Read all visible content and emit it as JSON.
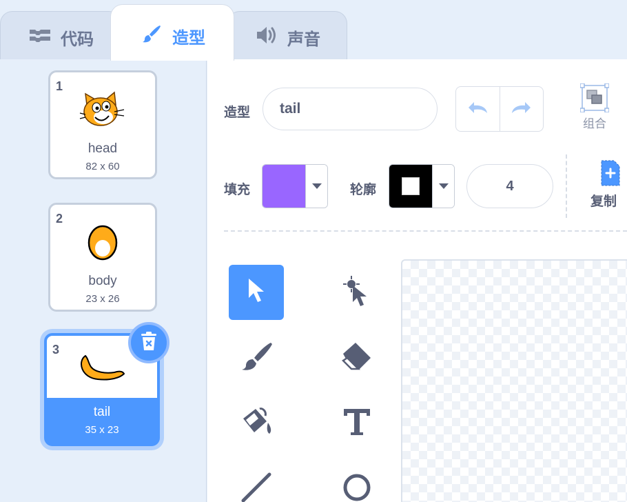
{
  "tabs": [
    {
      "label": "代码",
      "icon": "code-blocks-icon"
    },
    {
      "label": "造型",
      "icon": "brush-icon"
    },
    {
      "label": "声音",
      "icon": "speaker-icon"
    }
  ],
  "costumes": [
    {
      "number": "1",
      "name": "head",
      "size": "82 x 60"
    },
    {
      "number": "2",
      "name": "body",
      "size": "23 x 26"
    },
    {
      "number": "3",
      "name": "tail",
      "size": "35 x 23"
    }
  ],
  "editor": {
    "costume_label": "造型",
    "costume_name_value": "tail",
    "group_label": "组合",
    "fill_label": "填充",
    "outline_label": "轮廓",
    "stroke_width": "4",
    "copy_label": "复制"
  },
  "colors": {
    "accent": "#4c97ff",
    "fill_color": "#9966ff",
    "outline_color": "#000000",
    "text": "#575e75"
  }
}
